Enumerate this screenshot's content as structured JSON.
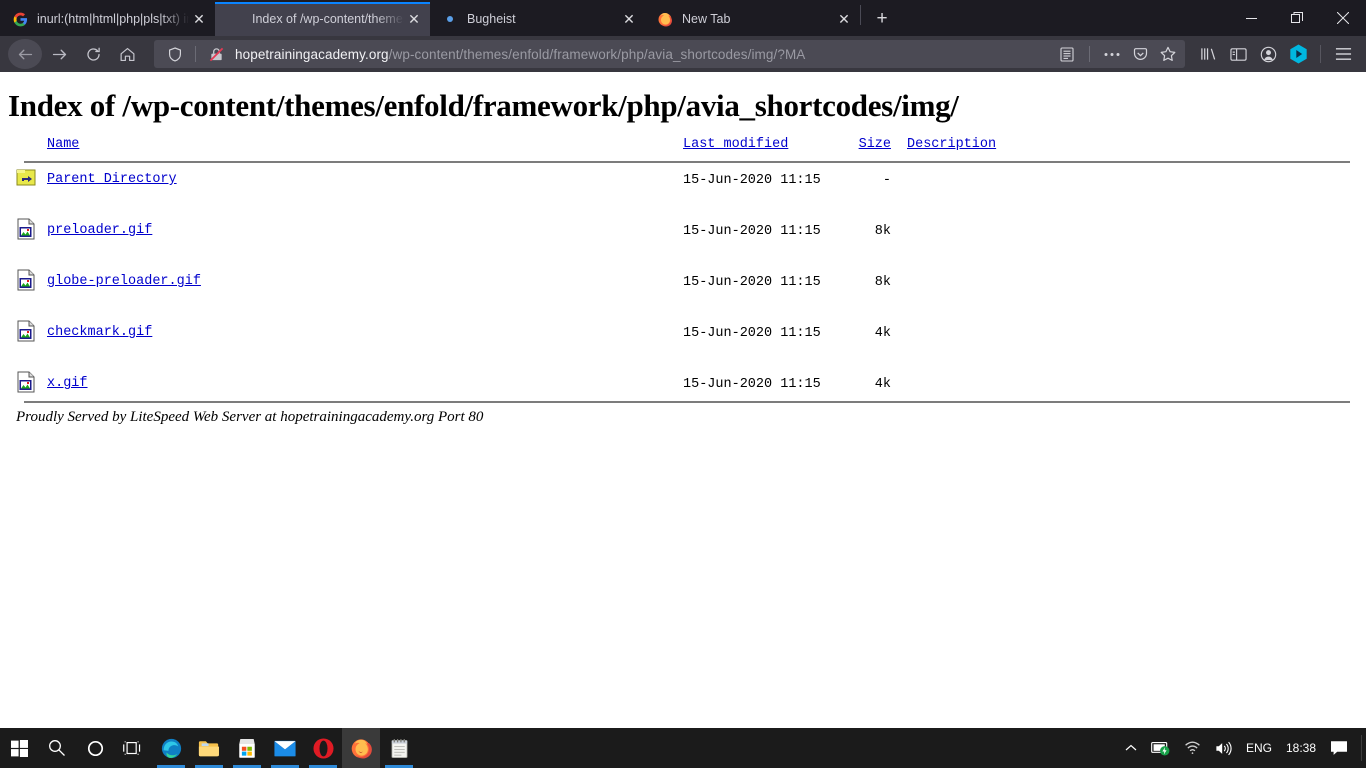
{
  "window": {
    "controls": {
      "minimize": "—",
      "maximize": "❐",
      "close": "✕"
    }
  },
  "tabs": [
    {
      "title": "inurl:(htm|html|php|pls|txt) int",
      "favicon": "google-icon",
      "close_label": "✕",
      "active": false
    },
    {
      "title": "Index of /wp-content/themes/enfo",
      "favicon": "page-icon",
      "close_label": "✕",
      "active": true
    },
    {
      "title": "Bugheist",
      "favicon": "dot-icon",
      "close_label": "✕",
      "active": false
    },
    {
      "title": "New Tab",
      "favicon": "firefox-icon",
      "close_label": "✕",
      "active": false
    }
  ],
  "newtab_label": "+",
  "navigation": {
    "back_label": "←",
    "forward_label": "→",
    "reload_label": "↻",
    "home_label": "⌂"
  },
  "urlbar": {
    "host": "hopetrainingacademy.org",
    "path": "/wp-content/themes/enfold/framework/php/avia_shortcodes/img/?MA",
    "shield_icon": "shield-icon",
    "lock_icon": "broken-lock-icon",
    "reader_icon": "reader-view-icon",
    "page_actions_icon": "ellipsis-icon",
    "pocket_icon": "pocket-icon",
    "bookmark_icon": "star-icon"
  },
  "toolbar_right": {
    "library_icon": "library-icon",
    "sidebar_icon": "sidebar-icon",
    "account_icon": "account-icon",
    "extension_icon": "extension-hexagon-icon",
    "menu_icon": "hamburger-menu-icon"
  },
  "page": {
    "title": "Index of /wp-content/themes/enfold/framework/php/avia_shortcodes/img/",
    "columns": {
      "name": "Name",
      "last_modified": "Last modified",
      "size": "Size",
      "description": "Description"
    },
    "rows": [
      {
        "icon": "parent-directory-icon",
        "name": "Parent Directory",
        "last_modified": "15-Jun-2020 11:15",
        "size": "-",
        "description": ""
      },
      {
        "icon": "image-file-icon",
        "name": "preloader.gif",
        "last_modified": "15-Jun-2020 11:15",
        "size": "8k",
        "description": ""
      },
      {
        "icon": "image-file-icon",
        "name": "globe-preloader.gif",
        "last_modified": "15-Jun-2020 11:15",
        "size": "8k",
        "description": ""
      },
      {
        "icon": "image-file-icon",
        "name": "checkmark.gif",
        "last_modified": "15-Jun-2020 11:15",
        "size": "4k",
        "description": ""
      },
      {
        "icon": "image-file-icon",
        "name": "x.gif",
        "last_modified": "15-Jun-2020 11:15",
        "size": "4k",
        "description": ""
      }
    ],
    "footer": "Proudly Served by LiteSpeed Web Server at hopetrainingacademy.org Port 80"
  },
  "taskbar": {
    "items": [
      {
        "icon": "windows-start-icon",
        "state": ""
      },
      {
        "icon": "search-icon",
        "state": ""
      },
      {
        "icon": "cortana-icon",
        "state": ""
      },
      {
        "icon": "task-view-icon",
        "state": ""
      },
      {
        "icon": "edge-icon",
        "state": "running"
      },
      {
        "icon": "file-explorer-icon",
        "state": "running"
      },
      {
        "icon": "microsoft-store-icon",
        "state": "running"
      },
      {
        "icon": "mail-icon",
        "state": "running"
      },
      {
        "icon": "opera-icon",
        "state": "running"
      },
      {
        "icon": "firefox-icon",
        "state": "active"
      },
      {
        "icon": "notepad-icon",
        "state": "running"
      }
    ],
    "tray": {
      "chevron_icon": "chevron-up-icon",
      "display_icon": "display-battery-icon",
      "wifi_icon": "wifi-icon",
      "volume_icon": "volume-icon",
      "language": "ENG",
      "clock": "18:38",
      "action_center_icon": "action-center-icon"
    }
  },
  "colors": {
    "accent": "#0a84ff",
    "chrome_dark": "#1c1b22",
    "chrome_nav": "#38373f",
    "link": "#0000cc",
    "taskbar": "#1b1b1b"
  }
}
